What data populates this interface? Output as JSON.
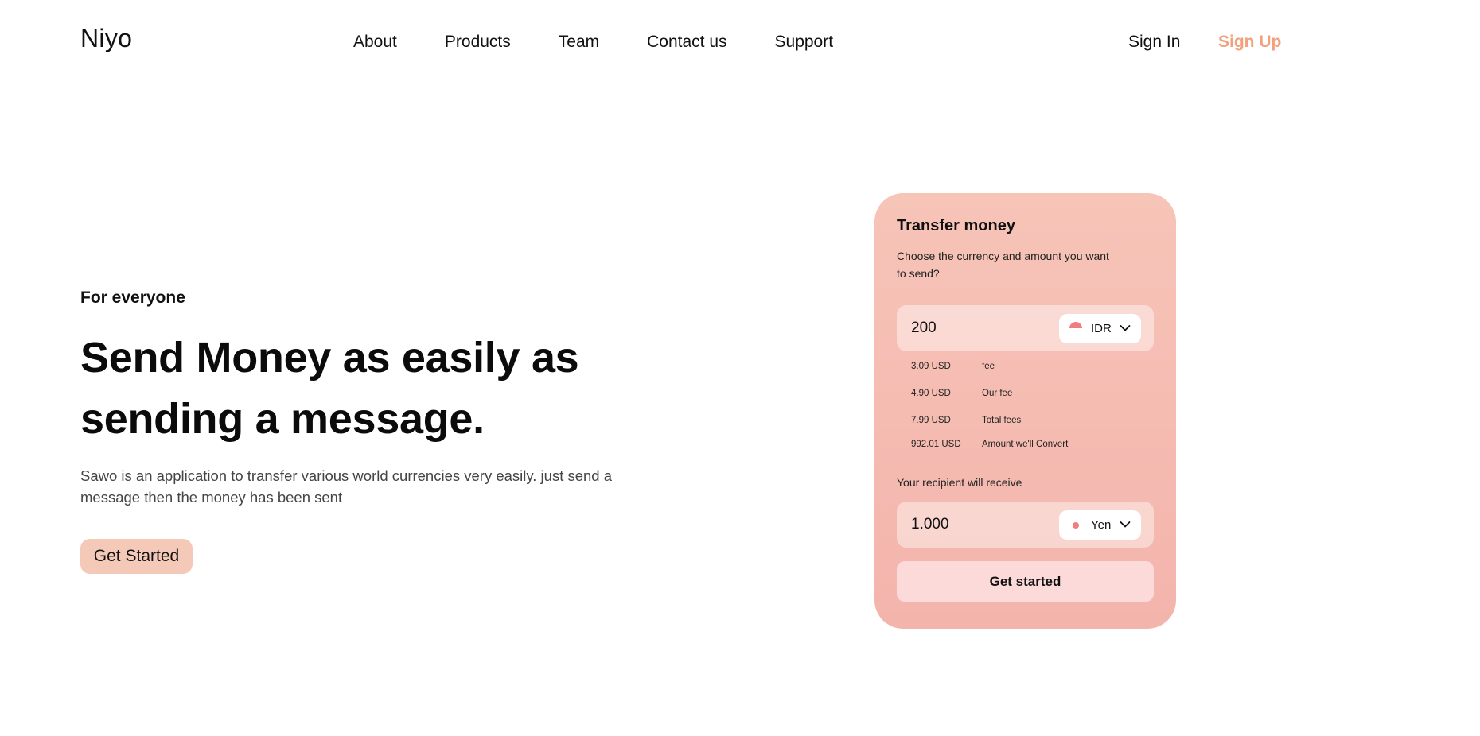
{
  "header": {
    "logo": "Niyo",
    "nav": [
      "About",
      "Products",
      "Team",
      "Contact us",
      "Support"
    ],
    "sign_in": "Sign In",
    "sign_up": "Sign Up"
  },
  "hero": {
    "eyebrow": "For everyone",
    "headline": "Send Money as easily as sending a message.",
    "description": "Sawo is an application to transfer various world currencies very easily. just send a message then the money has been sent",
    "cta": "Get Started"
  },
  "transfer_card": {
    "title": "Transfer money",
    "subtitle": "Choose the currency and amount you want to send?",
    "send_amount": "200",
    "send_currency": "IDR",
    "fees": [
      {
        "amount": "3.09 USD",
        "label": "fee"
      },
      {
        "amount": "4.90 USD",
        "label": "Our fee"
      },
      {
        "amount": "7.99 USD",
        "label": "Total fees"
      },
      {
        "amount": "992.01 USD",
        "label": "Amount we'll Convert"
      }
    ],
    "recipient_label": "Your recipient will receive",
    "receive_amount": "1.000",
    "receive_currency": "Yen",
    "button": "Get started"
  },
  "colors": {
    "accent": "#F2A07E",
    "cta_bg": "#F4C9B8",
    "card_bg": "#F3B4AC",
    "card_button_bg": "#FDDADA",
    "flag_red": "#F07E7E"
  },
  "icons": {
    "send_flag": "idr-flag-icon",
    "receive_flag": "yen-flag-icon",
    "dropdown": "chevron-down-icon"
  }
}
